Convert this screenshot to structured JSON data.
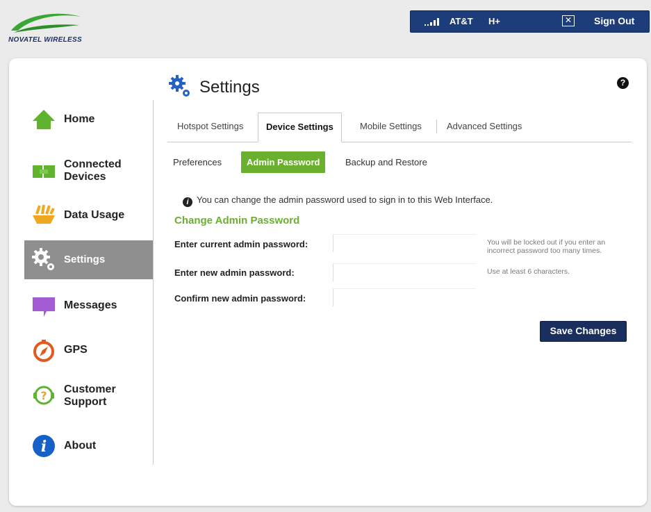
{
  "brand": {
    "name": "NOVATEL WIRELESS"
  },
  "status_bar": {
    "carrier": "AT&T",
    "network": "H+",
    "sign_out": "Sign Out"
  },
  "sidebar": {
    "items": [
      {
        "label": "Home",
        "icon": "home-icon"
      },
      {
        "label": "Connected Devices",
        "icon": "connected-devices-icon"
      },
      {
        "label": "Data Usage",
        "icon": "data-usage-icon"
      },
      {
        "label": "Settings",
        "icon": "settings-gear-icon",
        "active": true
      },
      {
        "label": "Messages",
        "icon": "messages-icon"
      },
      {
        "label": "GPS",
        "icon": "gps-compass-icon"
      },
      {
        "label": "Customer Support",
        "icon": "customer-support-icon"
      },
      {
        "label": "About",
        "icon": "about-info-icon"
      }
    ]
  },
  "page": {
    "title": "Settings"
  },
  "tabs": [
    {
      "label": "Hotspot Settings"
    },
    {
      "label": "Device Settings",
      "active": true
    },
    {
      "label": "Mobile Settings"
    },
    {
      "label": "Advanced Settings"
    }
  ],
  "subtabs": [
    {
      "label": "Preferences"
    },
    {
      "label": "Admin Password",
      "active": true
    },
    {
      "label": "Backup and Restore"
    }
  ],
  "info_text": "You can change the admin password used to sign in to this Web Interface.",
  "form": {
    "section_title": "Change Admin Password",
    "current_label": "Enter current admin password:",
    "current_value": "",
    "current_hint": "You will be locked out if you enter an incorrect password too many times.",
    "new_label": "Enter new admin password:",
    "new_value": "",
    "new_hint": "Use at least 6 characters.",
    "confirm_label": "Confirm new admin password:",
    "confirm_value": "",
    "save_label": "Save Changes"
  },
  "colors": {
    "accent_green": "#6ab02e",
    "navy": "#1d3d7a",
    "active_nav": "#8f8f8f"
  }
}
